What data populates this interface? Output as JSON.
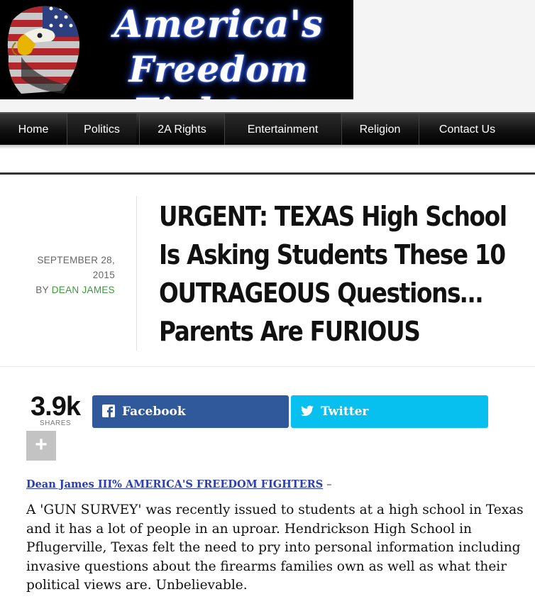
{
  "header": {
    "logo_line1": "America's",
    "logo_line2": "Freedom Fighters"
  },
  "nav": {
    "items": [
      {
        "label": "Home"
      },
      {
        "label": "Politics"
      },
      {
        "label": "2A Rights"
      },
      {
        "label": "Entertainment"
      },
      {
        "label": "Religion"
      },
      {
        "label": "Contact Us"
      }
    ]
  },
  "article": {
    "date": "SEPTEMBER 28, 2015",
    "by_prefix": "BY",
    "author": "DEAN JAMES",
    "title": "URGENT: TEXAS High School Is Asking Students These 10 OUTRAGEOUS Questions… Parents Are FURIOUS",
    "byline_link": "Dean James III% AMERICA'S FREEDOM FIGHTERS",
    "byline_dash": "–",
    "paragraph": "A 'GUN SURVEY' was recently issued to students at a high school in Texas and it has a lot of people in an uproar. Hendrickson High School in Pflugerville, Texas felt the need to pry into personal information including invasive questions about the firearms families own as well as what their political views are. Unbelievable."
  },
  "share": {
    "count": "3.9k",
    "count_label": "SHARES",
    "facebook_label": "Facebook",
    "twitter_label": "Twitter",
    "more_label": "+",
    "facebook_color": "#30599c",
    "twitter_color": "#08c0ef"
  },
  "icons": {
    "facebook": "facebook-icon",
    "twitter": "twitter-icon",
    "plus": "plus-icon",
    "eagle": "eagle-flag-icon"
  }
}
